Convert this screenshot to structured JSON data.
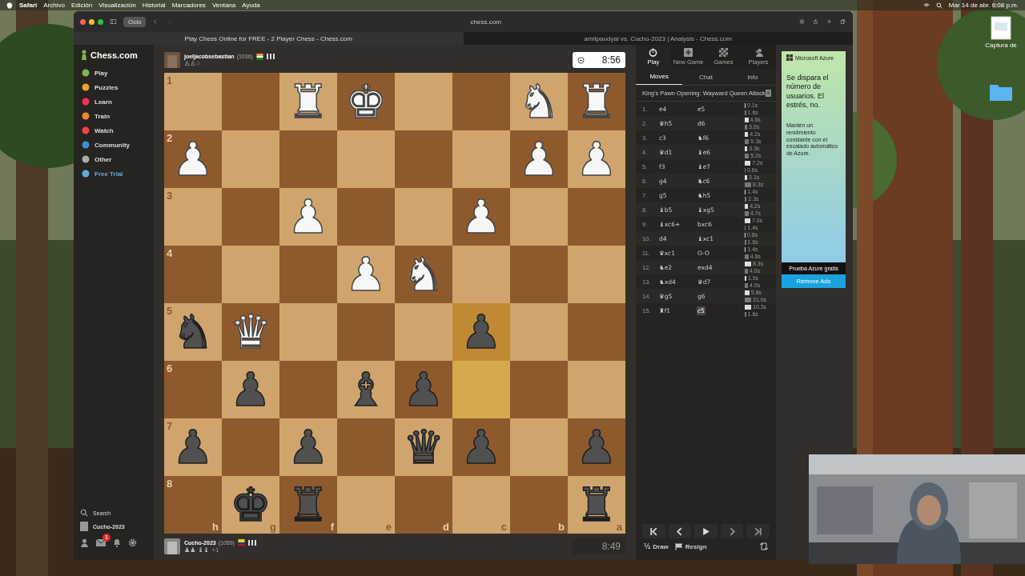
{
  "menu_bar": {
    "app": "Safari",
    "items": [
      "Archivo",
      "Edición",
      "Visualización",
      "Historial",
      "Marcadores",
      "Ventana",
      "Ayuda"
    ],
    "clock": "Mar 14 de abr.  6:08 p.m."
  },
  "desktop": {
    "icon_label": "Captura de"
  },
  "browser": {
    "tab_group": "Ocio",
    "address": "chess.com",
    "tabs": [
      {
        "title": "Play Chess Online for FREE - 2 Player Chess - Chess.com",
        "selected": true
      },
      {
        "title": "amitpaudyal vs. Cucho-2023 | Analysis - Chess.com",
        "selected": false
      }
    ]
  },
  "sidebar": {
    "logo": "Chess.com",
    "items": [
      {
        "label": "Play",
        "kind": "nav"
      },
      {
        "label": "Puzzles",
        "kind": "nav"
      },
      {
        "label": "Learn",
        "kind": "nav"
      },
      {
        "label": "Train",
        "kind": "nav"
      },
      {
        "label": "Watch",
        "kind": "nav"
      },
      {
        "label": "Community",
        "kind": "nav"
      },
      {
        "label": "Other",
        "kind": "nav"
      },
      {
        "label": "Free Trial",
        "kind": "promo"
      }
    ],
    "search": "Search",
    "user": "Cucho-2023",
    "mail_badge": "1"
  },
  "top_player": {
    "name": "joeljacobsebastian",
    "rating": "(1036)",
    "captured": "♙♙♘",
    "clock": "8:56",
    "active": true
  },
  "bottom_player": {
    "name": "Cucho-2023",
    "rating": "(1059)",
    "captured": "♟♟ ♝♝",
    "advantage": "+1",
    "clock": "8:49",
    "active": false
  },
  "board": {
    "ranks": [
      "1",
      "2",
      "3",
      "4",
      "5",
      "6",
      "7",
      "8"
    ],
    "files": [
      "h",
      "g",
      "f",
      "e",
      "d",
      "c",
      "b",
      "a"
    ],
    "rows": [
      [
        {
          "highlighted": false
        },
        {
          "highlighted": false
        },
        {
          "highlighted": false,
          "color": "#f7f7f7",
          "glyph": "♜"
        },
        {
          "highlighted": false,
          "color": "#f7f7f7",
          "glyph": "♚"
        },
        {
          "highlighted": false
        },
        {
          "highlighted": false
        },
        {
          "highlighted": false,
          "color": "#f7f7f7",
          "glyph": "♞"
        },
        {
          "highlighted": false,
          "color": "#f7f7f7",
          "glyph": "♜"
        }
      ],
      [
        {
          "highlighted": false,
          "color": "#f7f7f7",
          "glyph": "♟"
        },
        {
          "highlighted": false
        },
        {
          "highlighted": false
        },
        {
          "highlighted": false
        },
        {
          "highlighted": false
        },
        {
          "highlighted": false
        },
        {
          "highlighted": false,
          "color": "#f7f7f7",
          "glyph": "♟"
        },
        {
          "highlighted": false,
          "color": "#f7f7f7",
          "glyph": "♟"
        }
      ],
      [
        {
          "highlighted": false
        },
        {
          "highlighted": false
        },
        {
          "highlighted": false,
          "color": "#f7f7f7",
          "glyph": "♟"
        },
        {
          "highlighted": false
        },
        {
          "highlighted": false
        },
        {
          "highlighted": false,
          "color": "#f7f7f7",
          "glyph": "♟"
        },
        {
          "highlighted": false
        },
        {
          "highlighted": false
        }
      ],
      [
        {
          "highlighted": false
        },
        {
          "highlighted": false
        },
        {
          "highlighted": false
        },
        {
          "highlighted": false,
          "color": "#f7f7f7",
          "glyph": "♟"
        },
        {
          "highlighted": false,
          "color": "#f7f7f7",
          "glyph": "♞"
        },
        {
          "highlighted": false
        },
        {
          "highlighted": false
        },
        {
          "highlighted": false
        }
      ],
      [
        {
          "highlighted": false,
          "color": "#505050",
          "glyph": "♞"
        },
        {
          "highlighted": false,
          "color": "#f7f7f7",
          "glyph": "♛"
        },
        {
          "highlighted": false
        },
        {
          "highlighted": false
        },
        {
          "highlighted": false
        },
        {
          "highlighted": true,
          "color": "#505050",
          "glyph": "♟"
        },
        {
          "highlighted": false
        },
        {
          "highlighted": false
        }
      ],
      [
        {
          "highlighted": false
        },
        {
          "highlighted": false,
          "color": "#505050",
          "glyph": "♟"
        },
        {
          "highlighted": false
        },
        {
          "highlighted": false,
          "color": "#505050",
          "glyph": "♝"
        },
        {
          "highlighted": false,
          "color": "#505050",
          "glyph": "♟"
        },
        {
          "highlighted": true
        },
        {
          "highlighted": false
        },
        {
          "highlighted": false
        }
      ],
      [
        {
          "highlighted": false,
          "color": "#505050",
          "glyph": "♟"
        },
        {
          "highlighted": false
        },
        {
          "highlighted": false,
          "color": "#505050",
          "glyph": "♟"
        },
        {
          "highlighted": false
        },
        {
          "highlighted": false,
          "color": "#505050",
          "glyph": "♛"
        },
        {
          "highlighted": false,
          "color": "#505050",
          "glyph": "♟"
        },
        {
          "highlighted": false
        },
        {
          "highlighted": false,
          "color": "#505050",
          "glyph": "♟"
        }
      ],
      [
        {
          "highlighted": false
        },
        {
          "highlighted": false,
          "color": "#505050",
          "glyph": "♚"
        },
        {
          "highlighted": false,
          "color": "#505050",
          "glyph": "♜"
        },
        {
          "highlighted": false
        },
        {
          "highlighted": false
        },
        {
          "highlighted": false
        },
        {
          "highlighted": false
        },
        {
          "highlighted": false,
          "color": "#505050",
          "glyph": "♜"
        }
      ]
    ]
  },
  "panel": {
    "actions": [
      "Play",
      "New Game",
      "Games",
      "Players"
    ],
    "tabs": [
      {
        "label": "Moves",
        "selected": true
      },
      {
        "label": "Chat",
        "selected": false
      },
      {
        "label": "Info",
        "selected": false
      }
    ],
    "opening": "King's Pawn Opening: Wayward Queen Attack",
    "moves": [
      {
        "number": "1.",
        "white": {
          "san": "e4",
          "time": "0.1s",
          "selected": false
        },
        "black": {
          "san": "e5",
          "time": "1.6s",
          "selected": false
        }
      },
      {
        "number": "2.",
        "white": {
          "san": "♛h5",
          "time": "4.6s",
          "selected": false
        },
        "black": {
          "san": "d6",
          "time": "3.0s",
          "selected": false
        }
      },
      {
        "number": "3.",
        "white": {
          "san": "c3",
          "time": "4.2s",
          "selected": false
        },
        "black": {
          "san": "♞f6",
          "time": "5.3s",
          "selected": false
        }
      },
      {
        "number": "4.",
        "white": {
          "san": "♛d1",
          "time": "3.3s",
          "selected": false
        },
        "black": {
          "san": "♝e6",
          "time": "5.2s",
          "selected": false
        }
      },
      {
        "number": "5.",
        "white": {
          "san": "f3",
          "time": "7.2s",
          "selected": false
        },
        "black": {
          "san": "♝e7",
          "time": "0.6s",
          "selected": false
        }
      },
      {
        "number": "6.",
        "white": {
          "san": "g4",
          "time": "3.1s",
          "selected": false
        },
        "black": {
          "san": "♞c6",
          "time": "8.3s",
          "selected": false
        }
      },
      {
        "number": "7.",
        "white": {
          "san": "g5",
          "time": "1.4s",
          "selected": false
        },
        "black": {
          "san": "♞h5",
          "time": "2.3s",
          "selected": false
        }
      },
      {
        "number": "8.",
        "white": {
          "san": "♝b5",
          "time": "4.2s",
          "selected": false
        },
        "black": {
          "san": "♝xg5",
          "time": "4.7s",
          "selected": false
        }
      },
      {
        "number": "9.",
        "white": {
          "san": "♝xc6+",
          "time": "7.0s",
          "selected": false
        },
        "black": {
          "san": "bxc6",
          "time": "1.4s",
          "selected": false
        }
      },
      {
        "number": "10.",
        "white": {
          "san": "d4",
          "time": "0.8s",
          "selected": false
        },
        "black": {
          "san": "♝xc1",
          "time": "1.6s",
          "selected": false
        }
      },
      {
        "number": "11.",
        "white": {
          "san": "♛xc1",
          "time": "1.4s",
          "selected": false
        },
        "black": {
          "san": "O-O",
          "time": "4.8s",
          "selected": false
        }
      },
      {
        "number": "12.",
        "white": {
          "san": "♞e2",
          "time": "8.3s",
          "selected": false
        },
        "black": {
          "san": "exd4",
          "time": "4.0s",
          "selected": false
        }
      },
      {
        "number": "13.",
        "white": {
          "san": "♞xd4",
          "time": "1.9s",
          "selected": false
        },
        "black": {
          "san": "♛d7",
          "time": "4.0s",
          "selected": false
        }
      },
      {
        "number": "14.",
        "white": {
          "san": "♛g5",
          "time": "5.8s",
          "selected": false
        },
        "black": {
          "san": "g6",
          "time": "31.0s",
          "selected": false
        }
      },
      {
        "number": "15.",
        "white": {
          "san": "♜f1",
          "time": "10.3s",
          "selected": false
        },
        "black": {
          "san": "c5",
          "time": "1.6s",
          "selected": true
        }
      }
    ],
    "draw_icon": "½",
    "draw": "Draw",
    "resign": "Resign"
  },
  "ad": {
    "brand": "Microsoft Azure",
    "headline": "Se dispara el número de usuarios. El estrés, no.",
    "body": "Mantén un rendimiento constante con el escalado automático de Azure.",
    "cta": "Prueba Azure gratis",
    "remove": "Remove Ads"
  }
}
